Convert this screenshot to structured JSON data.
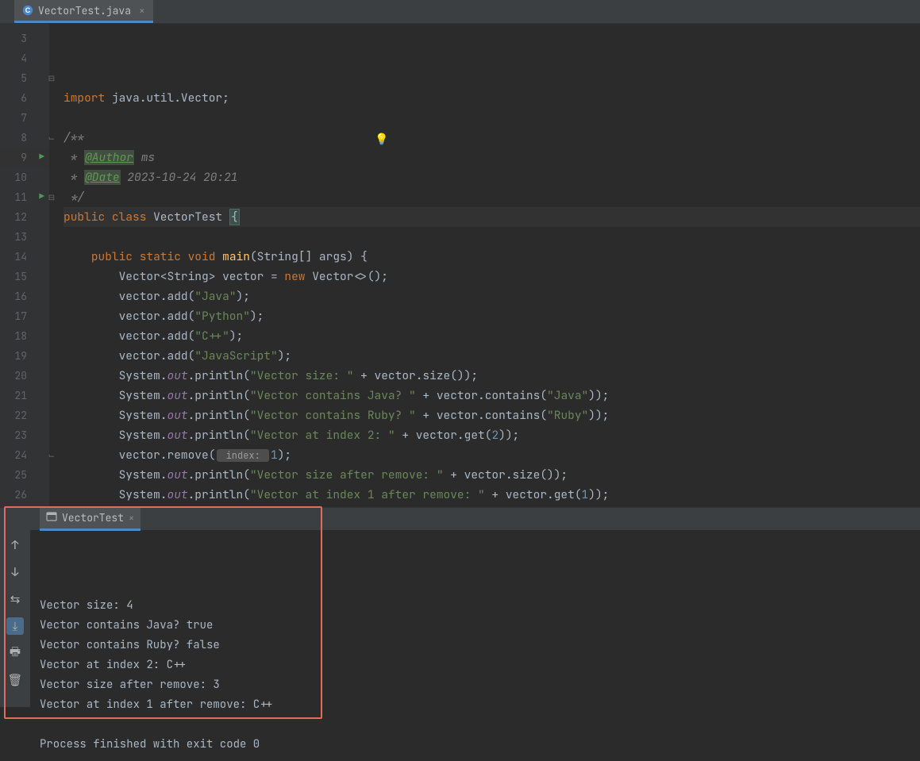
{
  "tab": {
    "filename": "VectorTest.java"
  },
  "code": {
    "line3": {
      "n": 3,
      "segments": [
        {
          "t": "import ",
          "c": "kw"
        },
        {
          "t": "java.util.Vector;",
          "c": ""
        }
      ]
    },
    "line4": {
      "n": 4,
      "segments": []
    },
    "line5": {
      "n": 5,
      "segments": [
        {
          "t": "/**",
          "c": "com"
        }
      ],
      "foldStart": true
    },
    "line6": {
      "n": 6,
      "segments": [
        {
          "t": " * ",
          "c": "com"
        },
        {
          "t": "@Author",
          "c": "ann-highlight"
        },
        {
          "t": " ms",
          "c": "itcom"
        }
      ]
    },
    "line7": {
      "n": 7,
      "segments": [
        {
          "t": " * ",
          "c": "com"
        },
        {
          "t": "@Date",
          "c": "ann-highlight"
        },
        {
          "t": " 2023-10-24 20:21",
          "c": "itcom"
        }
      ]
    },
    "line8": {
      "n": 8,
      "segments": [
        {
          "t": " */",
          "c": "com"
        }
      ],
      "foldEnd": true
    },
    "line9": {
      "n": 9,
      "segments": [
        {
          "t": "public class ",
          "c": "kw"
        },
        {
          "t": "VectorTest ",
          "c": "cls"
        },
        {
          "t": "{",
          "c": "brace-hl"
        }
      ],
      "run": true,
      "highlight": true
    },
    "line10": {
      "n": 10,
      "segments": []
    },
    "line11": {
      "n": 11,
      "segments": [
        {
          "t": "    ",
          "c": ""
        },
        {
          "t": "public static void ",
          "c": "kw"
        },
        {
          "t": "main",
          "c": "mth"
        },
        {
          "t": "(String[] args) {",
          "c": ""
        }
      ],
      "run": true,
      "foldStart": true
    },
    "line12": {
      "n": 12,
      "segments": [
        {
          "t": "        Vector<String> vector = ",
          "c": ""
        },
        {
          "t": "new ",
          "c": "kw"
        },
        {
          "t": "Vector<>();",
          "c": ""
        }
      ]
    },
    "line13": {
      "n": 13,
      "segments": [
        {
          "t": "        vector.add(",
          "c": ""
        },
        {
          "t": "\"Java\"",
          "c": "str"
        },
        {
          "t": ");",
          "c": ""
        }
      ]
    },
    "line14": {
      "n": 14,
      "segments": [
        {
          "t": "        vector.add(",
          "c": ""
        },
        {
          "t": "\"Python\"",
          "c": "str"
        },
        {
          "t": ");",
          "c": ""
        }
      ]
    },
    "line15": {
      "n": 15,
      "segments": [
        {
          "t": "        vector.add(",
          "c": ""
        },
        {
          "t": "\"C++\"",
          "c": "str"
        },
        {
          "t": ");",
          "c": ""
        }
      ]
    },
    "line16": {
      "n": 16,
      "segments": [
        {
          "t": "        vector.add(",
          "c": ""
        },
        {
          "t": "\"JavaScript\"",
          "c": "str"
        },
        {
          "t": ");",
          "c": ""
        }
      ]
    },
    "line17": {
      "n": 17,
      "segments": [
        {
          "t": "        System.",
          "c": ""
        },
        {
          "t": "out",
          "c": "fld"
        },
        {
          "t": ".println(",
          "c": ""
        },
        {
          "t": "\"Vector size: \"",
          "c": "str"
        },
        {
          "t": " + vector.size());",
          "c": ""
        }
      ]
    },
    "line18": {
      "n": 18,
      "segments": [
        {
          "t": "        System.",
          "c": ""
        },
        {
          "t": "out",
          "c": "fld"
        },
        {
          "t": ".println(",
          "c": ""
        },
        {
          "t": "\"Vector contains Java? \"",
          "c": "str"
        },
        {
          "t": " + vector.contains(",
          "c": ""
        },
        {
          "t": "\"Java\"",
          "c": "str"
        },
        {
          "t": "));",
          "c": ""
        }
      ]
    },
    "line19": {
      "n": 19,
      "segments": [
        {
          "t": "        System.",
          "c": ""
        },
        {
          "t": "out",
          "c": "fld"
        },
        {
          "t": ".println(",
          "c": ""
        },
        {
          "t": "\"Vector contains Ruby? \"",
          "c": "str"
        },
        {
          "t": " + vector.contains(",
          "c": ""
        },
        {
          "t": "\"Ruby\"",
          "c": "str"
        },
        {
          "t": "));",
          "c": ""
        }
      ]
    },
    "line20": {
      "n": 20,
      "segments": [
        {
          "t": "        System.",
          "c": ""
        },
        {
          "t": "out",
          "c": "fld"
        },
        {
          "t": ".println(",
          "c": ""
        },
        {
          "t": "\"Vector at index 2: \"",
          "c": "str"
        },
        {
          "t": " + vector.get(",
          "c": ""
        },
        {
          "t": "2",
          "c": "num"
        },
        {
          "t": "));",
          "c": ""
        }
      ]
    },
    "line21": {
      "n": 21,
      "segments": [
        {
          "t": "        vector.remove(",
          "c": ""
        },
        {
          "t": " index: ",
          "c": "param-hint"
        },
        {
          "t": "1",
          "c": "num"
        },
        {
          "t": ");",
          "c": ""
        }
      ]
    },
    "line22": {
      "n": 22,
      "segments": [
        {
          "t": "        System.",
          "c": ""
        },
        {
          "t": "out",
          "c": "fld"
        },
        {
          "t": ".println(",
          "c": ""
        },
        {
          "t": "\"Vector size after remove: \"",
          "c": "str"
        },
        {
          "t": " + vector.size());",
          "c": ""
        }
      ]
    },
    "line23": {
      "n": 23,
      "segments": [
        {
          "t": "        System.",
          "c": ""
        },
        {
          "t": "out",
          "c": "fld"
        },
        {
          "t": ".println(",
          "c": ""
        },
        {
          "t": "\"Vector at index 1 after remove: \"",
          "c": "str"
        },
        {
          "t": " + vector.get(",
          "c": ""
        },
        {
          "t": "1",
          "c": "num"
        },
        {
          "t": "));",
          "c": ""
        }
      ]
    },
    "line24": {
      "n": 24,
      "segments": [
        {
          "t": "    }",
          "c": ""
        }
      ],
      "foldEnd": true
    },
    "line25": {
      "n": 25,
      "segments": [
        {
          "t": "}",
          "c": "brace-hl"
        }
      ]
    },
    "line26": {
      "n": 26,
      "segments": []
    }
  },
  "run": {
    "label": "",
    "tab_name": "VectorTest",
    "output": [
      "Vector size: 4",
      "Vector contains Java? true",
      "Vector contains Ruby? false",
      "Vector at index 2: C++",
      "Vector size after remove: 3",
      "Vector at index 1 after remove: C++",
      "",
      "Process finished with exit code 0"
    ]
  },
  "toolbar": {
    "up": "↑",
    "down": "↓",
    "wrap": "⇆",
    "scroll": "⤓",
    "print": "🖶",
    "delete": "🗑"
  }
}
